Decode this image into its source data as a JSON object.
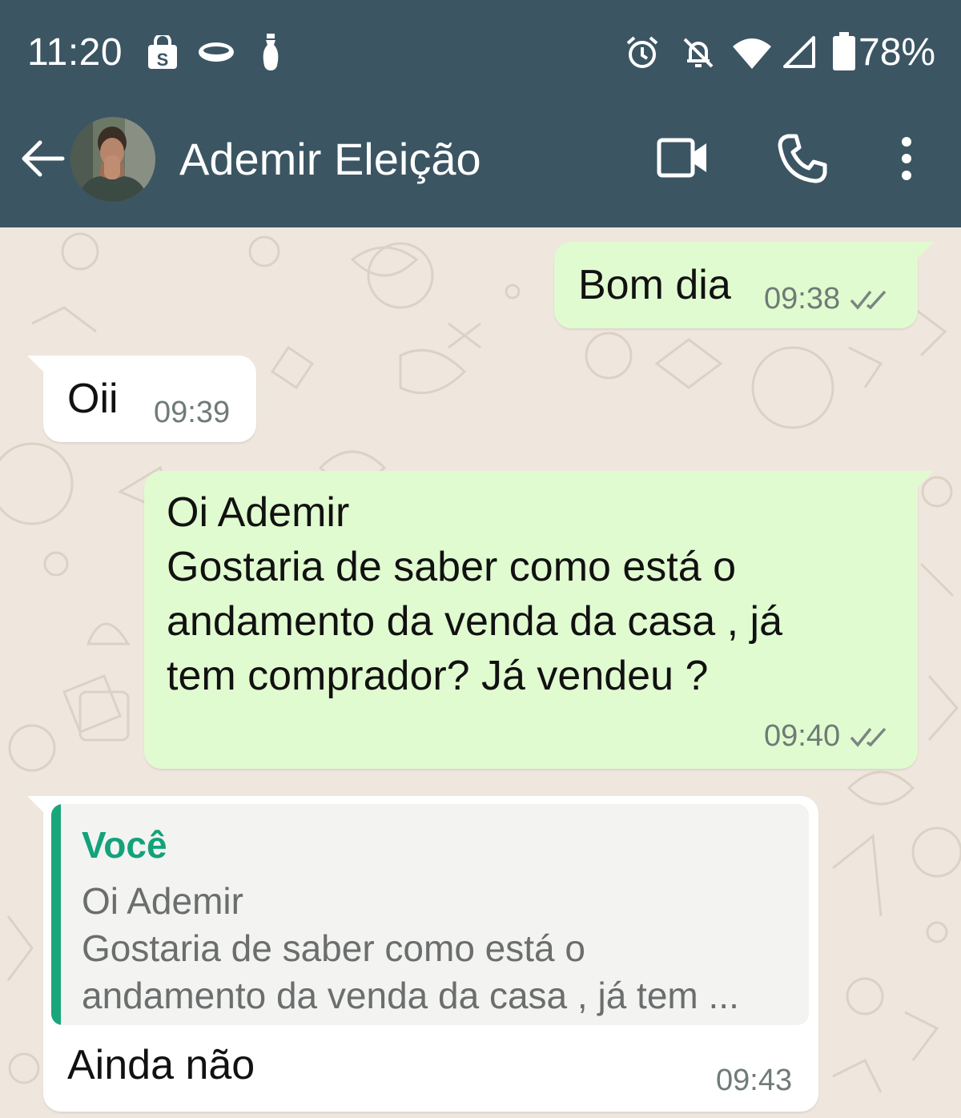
{
  "status_bar": {
    "time": "11:20",
    "left_icons": [
      "shopping-bag-icon",
      "eye-icon",
      "vase-icon"
    ],
    "right_icons": [
      "alarm-icon",
      "notifications-off-icon",
      "wifi-icon",
      "signal-icon",
      "battery-icon"
    ],
    "battery": "78%"
  },
  "header": {
    "back_icon": "arrow-left-icon",
    "contact_name": "Ademir Eleição",
    "actions": [
      "video-call-icon",
      "phone-icon",
      "more-vertical-icon"
    ],
    "color": "#3b5563"
  },
  "messages": [
    {
      "direction": "outgoing",
      "text": "Bom dia",
      "time": "09:38",
      "status": "double-check-icon"
    },
    {
      "direction": "incoming",
      "text": "Oii",
      "time": "09:39"
    },
    {
      "direction": "outgoing",
      "text": "Oi Ademir\nGostaria de saber como está o\nandamento da venda da casa , já\ntem comprador? Já vendeu ?",
      "time": "09:40",
      "status": "double-check-icon"
    },
    {
      "direction": "incoming",
      "quote": {
        "author": "Você",
        "text": "Oi Ademir\nGostaria de saber como está o\nandamento da venda da casa , já tem ..."
      },
      "text": "Ainda não",
      "time": "09:43"
    }
  ],
  "colors": {
    "outgoing_bubble": "#e1fbd0",
    "incoming_bubble": "#ffffff",
    "quote_accent": "#13a27a",
    "chat_background": "#efe7de"
  }
}
